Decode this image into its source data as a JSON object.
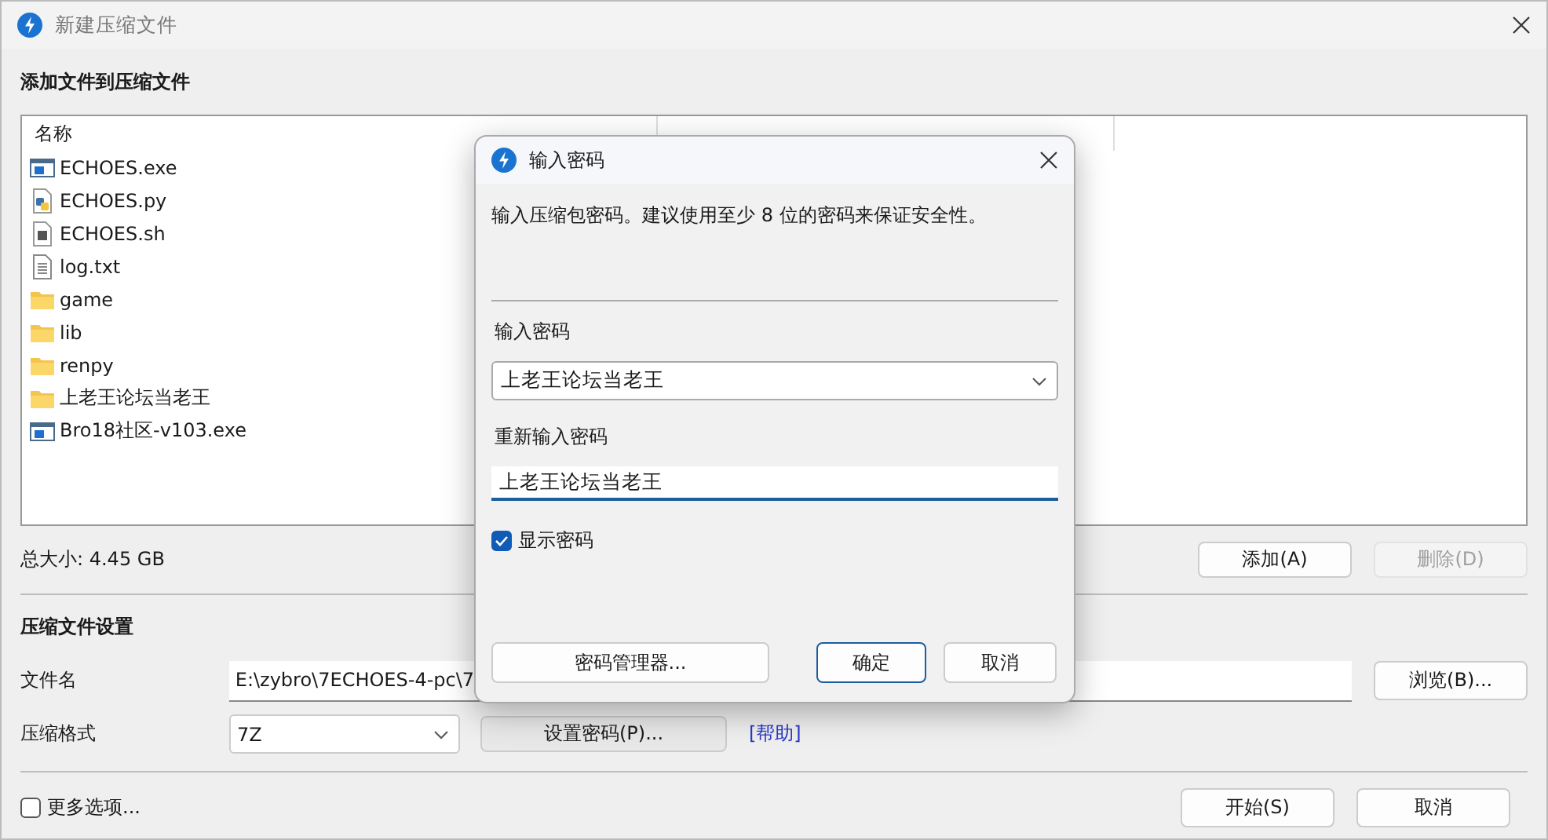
{
  "window": {
    "title": "新建压缩文件"
  },
  "add_section": {
    "heading": "添加文件到压缩文件",
    "list": {
      "columns": [
        "名称"
      ],
      "items": [
        {
          "name": "ECHOES.exe",
          "kind": "exe"
        },
        {
          "name": "ECHOES.py",
          "kind": "py"
        },
        {
          "name": "ECHOES.sh",
          "kind": "sh"
        },
        {
          "name": "log.txt",
          "kind": "txt"
        },
        {
          "name": "game",
          "kind": "folder"
        },
        {
          "name": "lib",
          "kind": "folder"
        },
        {
          "name": "renpy",
          "kind": "folder"
        },
        {
          "name": "上老王论坛当老王",
          "kind": "folder"
        },
        {
          "name": "Bro18社区-v103.exe",
          "kind": "exe"
        }
      ]
    },
    "total_size": "总大小: 4.45 GB",
    "buttons": [
      {
        "label": "添加(A)",
        "disabled": false
      },
      {
        "label": "删除(D)",
        "disabled": true
      }
    ]
  },
  "settings": {
    "heading": "压缩文件设置",
    "filename": {
      "label": "文件名",
      "value": "E:\\zybro\\7ECHOES-4-pc\\7"
    },
    "browse_button": "浏览(B)...",
    "format": {
      "label": "压缩格式",
      "value": "7Z"
    },
    "set_password_button": "设置密码(P)...",
    "help_link": "[帮助]"
  },
  "more_options": {
    "label": "更多选项...",
    "checked": false
  },
  "footer_buttons": [
    {
      "label": "开始(S)"
    },
    {
      "label": "取消"
    }
  ],
  "password_dialog": {
    "title": "输入密码",
    "description": "输入压缩包密码。建议使用至少 8 位的密码来保证安全性。",
    "password": {
      "label": "输入密码",
      "value": "上老王论坛当老王"
    },
    "confirm": {
      "label": "重新输入密码",
      "value": "上老王论坛当老王"
    },
    "show_password": {
      "label": "显示密码",
      "checked": true
    },
    "manager_button": "密码管理器...",
    "buttons": [
      {
        "label": "确定",
        "default": true
      },
      {
        "label": "取消",
        "default": false
      }
    ]
  }
}
